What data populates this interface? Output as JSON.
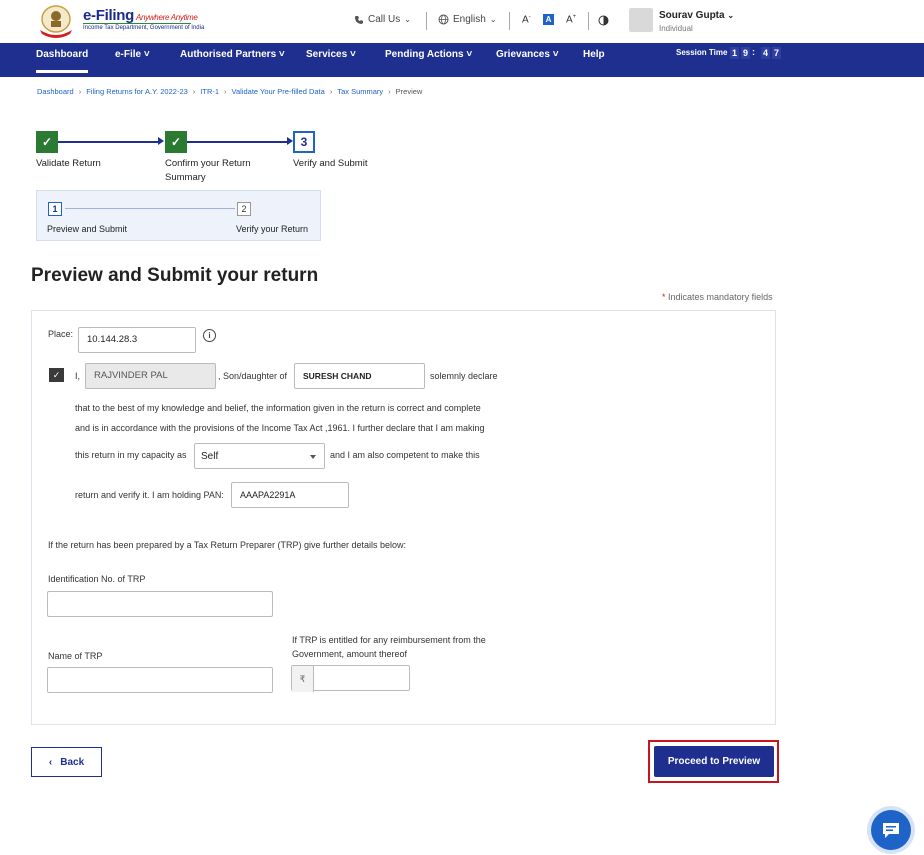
{
  "header": {
    "logo_title": "e-Filing",
    "logo_tagline": "Anywhere Anytime",
    "logo_subtitle": "Income Tax Department, Government of India",
    "call_us": "Call Us",
    "language": "English",
    "text_decrease": "A",
    "text_normal": "A",
    "text_increase": "A",
    "user_name": "Sourav Gupta",
    "user_role": "Individual"
  },
  "nav": {
    "items": [
      "Dashboard",
      "e-File",
      "Authorised Partners",
      "Services",
      "Pending Actions",
      "Grievances",
      "Help"
    ],
    "session_label": "Session Time",
    "session_digits": [
      "1",
      "9",
      "4",
      "7"
    ],
    "session_colon": ":"
  },
  "breadcrumb": [
    "Dashboard",
    "Filing Returns for A.Y. 2022-23",
    "ITR-1",
    "Validate Your Pre-filled Data",
    "Tax Summary",
    "Preview"
  ],
  "stepper": {
    "steps": [
      {
        "label": "Validate Return",
        "status": "done"
      },
      {
        "label_line1": "Confirm your Return",
        "label_line2": "Summary",
        "status": "done"
      },
      {
        "number": "3",
        "label": "Verify and Submit",
        "status": "current"
      }
    ],
    "substeps": [
      {
        "number": "1",
        "label": "Preview and Submit"
      },
      {
        "number": "2",
        "label": "Verify your Return"
      }
    ]
  },
  "page": {
    "title": "Preview and Submit your return",
    "mandatory_note": "Indicates mandatory fields",
    "mandatory_star": "*"
  },
  "form": {
    "place_label": "Place:",
    "place_value": "10.144.28.3",
    "info_icon": "i",
    "decl_i": "I,",
    "name_value": "RAJVINDER PAL",
    "son_daughter_of": ", Son/daughter of",
    "father_value": "SURESH CHAND",
    "solemnly_declare": "solemnly declare",
    "decl_line1": "that to the best of my knowledge and belief, the information given in the return is correct and complete",
    "decl_line2": "and is in accordance with the provisions of the Income Tax Act ,1961. I further declare that I am making",
    "decl_line3": "this return in my capacity as",
    "capacity_value": "Self",
    "decl_line3b": "and I am also competent to make this",
    "decl_line4": "return and verify it. I am holding PAN:",
    "pan_value": "AAAPA2291A",
    "trp_note": "If the return has been prepared by a Tax Return Preparer (TRP) give further details below:",
    "trp_id_label": "Identification No. of TRP",
    "trp_name_label": "Name of TRP",
    "reimbursement_label_line1": "If TRP is entitled for any reimbursement from the",
    "reimbursement_label_line2": "Government, amount thereof",
    "currency_symbol": "₹"
  },
  "actions": {
    "back_label": "Back",
    "back_chevron": "‹",
    "proceed_label": "Proceed to Preview"
  },
  "colors": {
    "nav_bg": "#1e2f8f",
    "step_done": "#2b7a32",
    "highlight": "#c8141e",
    "link": "#1e63c8"
  }
}
